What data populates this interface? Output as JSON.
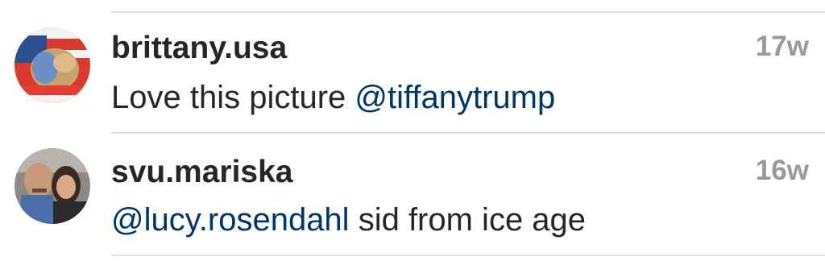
{
  "comments": [
    {
      "username": "brittany.usa",
      "timestamp": "17w",
      "text_before": "Love this picture ",
      "mention": "@tiffanytrump",
      "text_after": ""
    },
    {
      "username": "svu.mariska",
      "timestamp": "16w",
      "text_before": "",
      "mention": "@lucy.rosendahl",
      "text_after": " sid from ice age"
    }
  ],
  "colors": {
    "username": "#262626",
    "mention": "#003569",
    "timestamp": "#999999",
    "divider": "#dddddd"
  }
}
